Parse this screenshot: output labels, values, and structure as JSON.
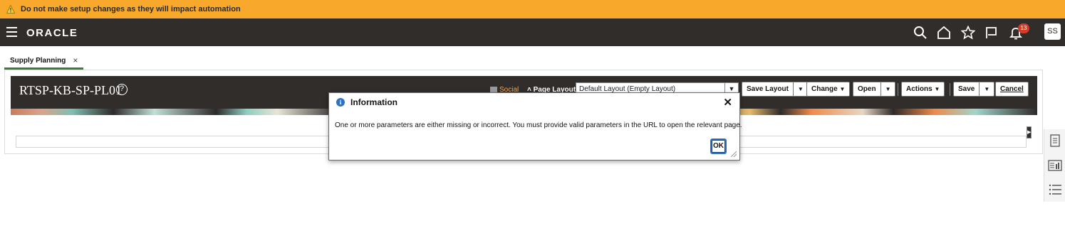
{
  "banner": {
    "message": "Do not make setup changes as they will impact automation",
    "color": "#f8a82b"
  },
  "header": {
    "logo": "ORACLE",
    "notification_count": "13",
    "avatar_initials": "SS",
    "bg": "#312d2a"
  },
  "tabs": [
    {
      "label": "Supply Planning",
      "close": "×"
    }
  ],
  "page": {
    "title": "RTSP-KB-SP-PL01",
    "help": "?",
    "social_label": "Social",
    "page_layout_label": "Page Layout",
    "page_layout_value": "Default Layout (Empty Layout)",
    "buttons": {
      "save_layout": "Save Layout",
      "change": "Change",
      "open": "Open",
      "actions": "Actions",
      "save": "Save",
      "cancel": "Cancel"
    }
  },
  "dialog": {
    "title": "Information",
    "message": "One or more parameters are either missing or incorrect. You must provide valid parameters in the URL to open the relevant page.",
    "close": "✕",
    "ok": "OK"
  },
  "icons": {
    "menu": "hamburger-icon",
    "search": "search-icon",
    "home": "home-icon",
    "favorites": "star-icon",
    "watchlist": "flag-icon",
    "notifications": "bell-icon",
    "rail": [
      "document-icon",
      "report-icon",
      "list-icon"
    ]
  }
}
